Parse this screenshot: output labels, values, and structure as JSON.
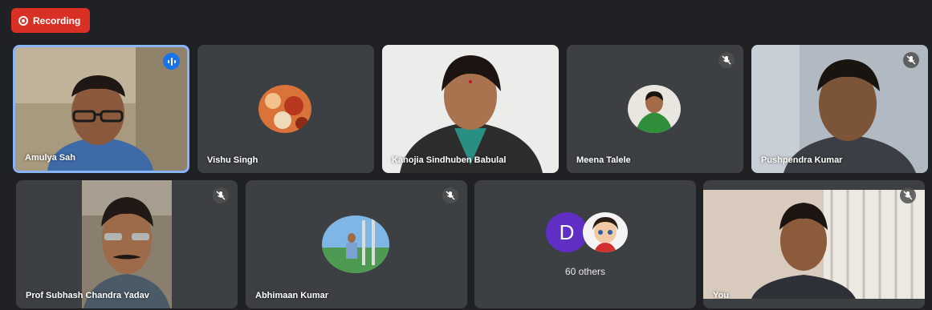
{
  "recording": {
    "label": "Recording"
  },
  "participants": [
    {
      "name": "Amulya Sah",
      "status": "speaking"
    },
    {
      "name": "Vishu Singh",
      "status": "muted"
    },
    {
      "name": "Kanojia Sindhuben Babulal",
      "status": "muted"
    },
    {
      "name": "Meena Talele",
      "status": "muted"
    },
    {
      "name": "Pushpendra Kumar",
      "status": "muted"
    },
    {
      "name": "Prof Subhash Chandra Yadav",
      "status": "muted"
    },
    {
      "name": "Abhimaan Kumar",
      "status": "muted"
    },
    {
      "name": "You",
      "status": "muted"
    }
  ],
  "others": {
    "initial": "D",
    "label": "60 others"
  },
  "colors": {
    "recording": "#d93025",
    "active_border": "#8ab4f8",
    "speaking": "#1a73e8",
    "tile": "#3c4043",
    "background": "#202124"
  },
  "icons": {
    "recording": "record-icon",
    "speaking": "audio-level-icon",
    "muted": "mic-off-icon"
  }
}
